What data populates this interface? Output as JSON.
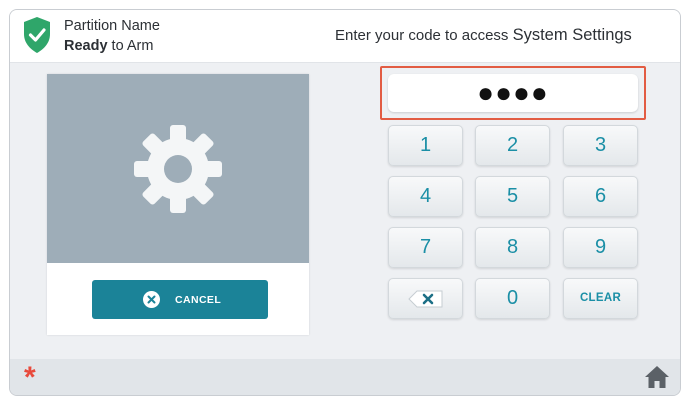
{
  "header": {
    "partition_name": "Partition Name",
    "status_bold": "Ready",
    "status_rest": " to Arm",
    "prompt_prefix": "Enter your code to access ",
    "prompt_target": "System Settings",
    "shield_color": "#2fa66a"
  },
  "settings_panel": {
    "icon": "gear-icon",
    "cancel_label": "CANCEL"
  },
  "code_entry": {
    "masked_value": "●●●●",
    "highlight_color": "#e25c43"
  },
  "keypad": {
    "keys": [
      "1",
      "2",
      "3",
      "4",
      "5",
      "6",
      "7",
      "8",
      "9",
      "",
      "0",
      "CLEAR"
    ],
    "backspace_icon": "backspace-icon"
  },
  "footer": {
    "asterisk": "*",
    "home_icon": "home-icon"
  }
}
